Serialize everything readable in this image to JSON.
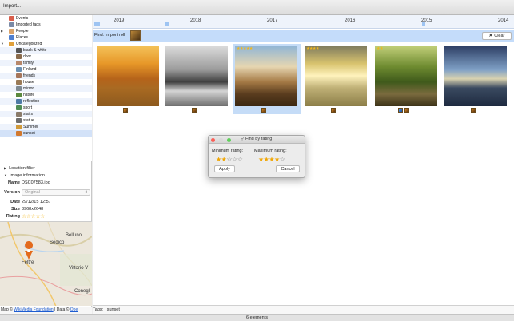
{
  "toolbar": {
    "import_label": "Import..."
  },
  "tree": {
    "items": [
      {
        "label": "Events",
        "level": 1,
        "icon_color": "#d95e4b",
        "expand": ""
      },
      {
        "label": "Imported tags",
        "level": 1,
        "icon_color": "#7a8aa6",
        "expand": ""
      },
      {
        "label": "People",
        "level": 1,
        "icon_color": "#d9a36b",
        "expand": "▶"
      },
      {
        "label": "Places",
        "level": 1,
        "icon_color": "#4f7fd0",
        "expand": ""
      },
      {
        "label": "Uncategorized",
        "level": 1,
        "icon_color": "#e0a03a",
        "expand": "▼"
      },
      {
        "label": "black & white",
        "level": 2,
        "icon_color": "#555555",
        "expand": ""
      },
      {
        "label": "door",
        "level": 2,
        "icon_color": "#8a6b4c",
        "expand": ""
      },
      {
        "label": "family",
        "level": 2,
        "icon_color": "#b7876a",
        "expand": ""
      },
      {
        "label": "Finland",
        "level": 2,
        "icon_color": "#6a8fb2",
        "expand": ""
      },
      {
        "label": "friends",
        "level": 2,
        "icon_color": "#a6765a",
        "expand": ""
      },
      {
        "label": "house",
        "level": 2,
        "icon_color": "#9a7a56",
        "expand": ""
      },
      {
        "label": "mirror",
        "level": 2,
        "icon_color": "#7f8a92",
        "expand": ""
      },
      {
        "label": "nature",
        "level": 2,
        "icon_color": "#5c8a3e",
        "expand": ""
      },
      {
        "label": "reflection",
        "level": 2,
        "icon_color": "#4d7aa5",
        "expand": ""
      },
      {
        "label": "sport",
        "level": 2,
        "icon_color": "#4f8c55",
        "expand": ""
      },
      {
        "label": "stairs",
        "level": 2,
        "icon_color": "#8a7b6a",
        "expand": ""
      },
      {
        "label": "statue",
        "level": 2,
        "icon_color": "#6d6d6d",
        "expand": ""
      },
      {
        "label": "Summer",
        "level": 2,
        "icon_color": "#d19a3a",
        "expand": ""
      },
      {
        "label": "sunset",
        "level": 2,
        "icon_color": "#d2792e",
        "expand": ""
      }
    ],
    "selected_index": 18
  },
  "sections": {
    "location_filter": "Location filter",
    "image_information": "Image information"
  },
  "info": {
    "name_key": "Name",
    "name_val": "DSC07583.jpg",
    "version_key": "Version",
    "version_val": "Original",
    "date_key": "Date",
    "date_val": "29/12/15 12:57",
    "size_key": "Size",
    "size_val": "3968x2648",
    "rating_key": "Rating",
    "rating_stars": "☆☆☆☆☆"
  },
  "map": {
    "labels": [
      "Belluno",
      "Sedico",
      "Feltre",
      "Vittorio V",
      "Conegli"
    ],
    "credit_prefix": "Map © ",
    "credit_link1": "WikiMedia Foundation",
    "credit_mid": " | Data © ",
    "credit_link2": "Ope"
  },
  "timeline": {
    "years": [
      "2019",
      "2018",
      "2017",
      "2016",
      "2015",
      "2014"
    ]
  },
  "find": {
    "label": "Find:  Import roll",
    "clear_label": "Clear"
  },
  "photos": [
    {
      "stars": "",
      "badges": [
        "roll"
      ]
    },
    {
      "stars": "",
      "badges": [
        "roll"
      ]
    },
    {
      "stars": "★★★★★",
      "badges": [
        "roll"
      ]
    },
    {
      "stars": "★★★★",
      "badges": [
        "roll"
      ]
    },
    {
      "stars": "★★",
      "badges": [
        "geo",
        "roll"
      ]
    },
    {
      "stars": "",
      "badges": [
        "roll"
      ]
    }
  ],
  "tags": {
    "label": "Tags:",
    "value": "sunset"
  },
  "status": {
    "count": "6 elements"
  },
  "dialog": {
    "title": "Find by rating",
    "min_label": "Minimum rating:",
    "min_filled": "★★",
    "min_empty": "☆☆☆",
    "max_label": "Maximum rating:",
    "max_filled": "★★★★",
    "max_empty": "☆",
    "apply_label": "Apply",
    "cancel_label": "Cancel"
  }
}
